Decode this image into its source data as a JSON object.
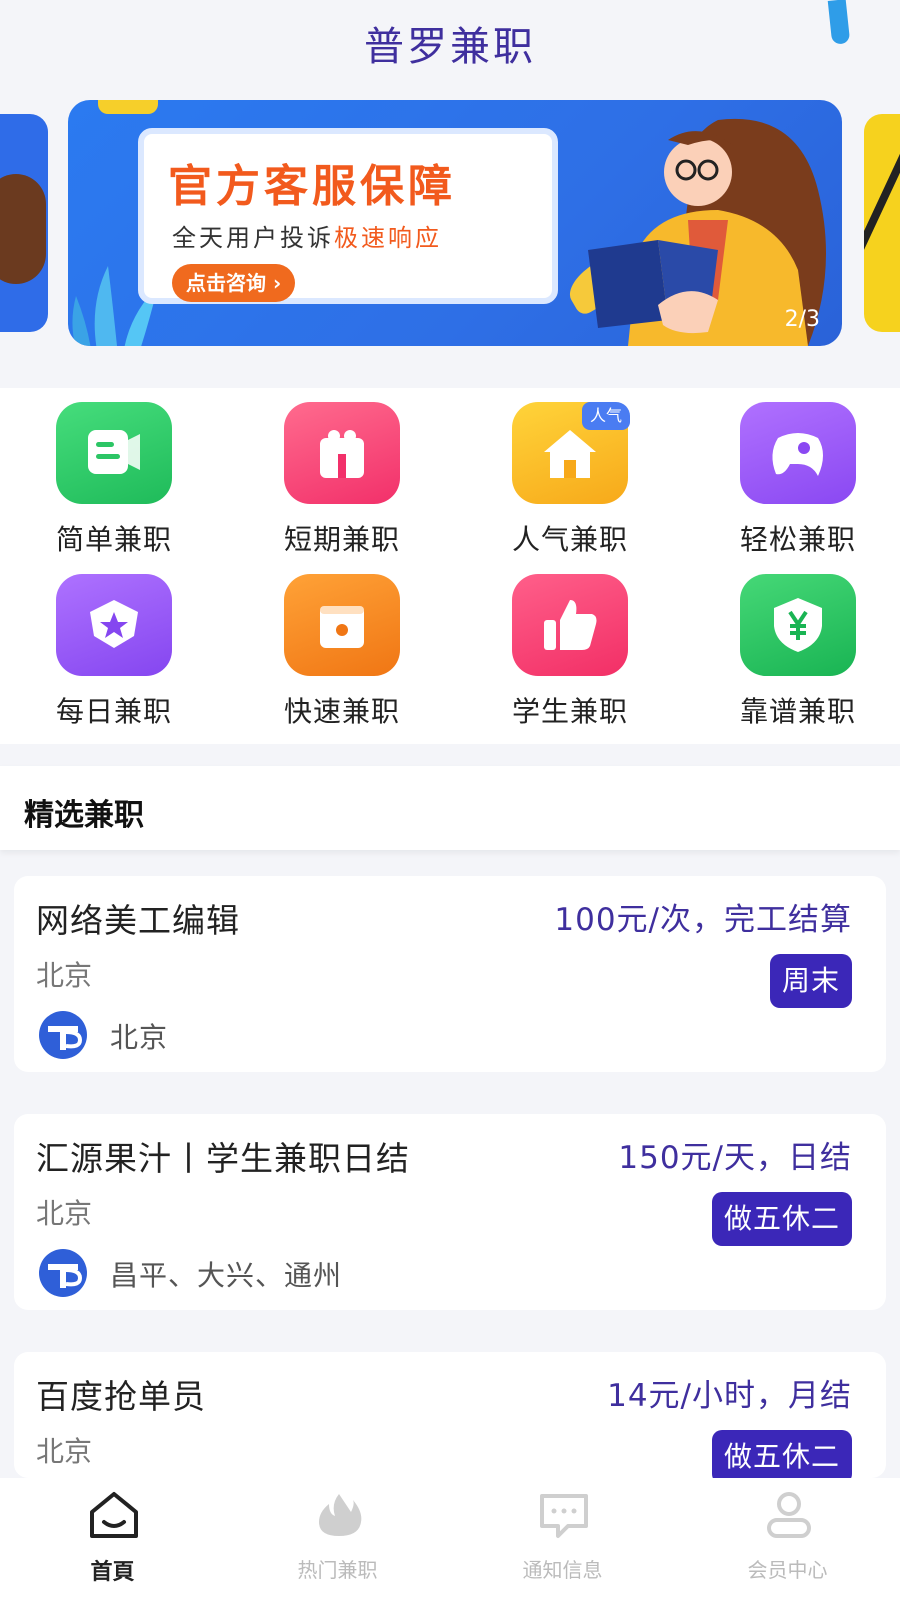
{
  "header": {
    "title": "普罗兼职"
  },
  "carousel": {
    "indicator": "2/3",
    "banner": {
      "headline": "官方客服保障",
      "subtitle_prefix": "全天用户投诉",
      "subtitle_highlight": "极速响应",
      "cta": "点击咨询 ›"
    }
  },
  "categories": [
    {
      "label": "简单兼职",
      "icon": "chat-doc-icon"
    },
    {
      "label": "短期兼职",
      "icon": "gift-box-icon"
    },
    {
      "label": "人气兼职",
      "icon": "house-icon",
      "badge": "人气"
    },
    {
      "label": "轻松兼职",
      "icon": "gamepad-icon"
    },
    {
      "label": "每日兼职",
      "icon": "star-badge-icon"
    },
    {
      "label": "快速兼职",
      "icon": "box-icon"
    },
    {
      "label": "学生兼职",
      "icon": "thumbs-up-icon"
    },
    {
      "label": "靠谱兼职",
      "icon": "yuan-shield-icon"
    }
  ],
  "section": {
    "title": "精选兼职"
  },
  "jobs": [
    {
      "title": "网络美工编辑",
      "pay": "100元/次，完工结算",
      "city": "北京",
      "tag": "周末",
      "area": "北京"
    },
    {
      "title": "汇源果汁丨学生兼职日结",
      "pay": "150元/天，日结",
      "city": "北京",
      "tag": "做五休二",
      "area": "昌平、大兴、通州"
    },
    {
      "title": "百度抢单员",
      "pay": "14元/小时，月结",
      "city": "北京",
      "tag": "做五休二",
      "area": ""
    }
  ],
  "tabbar": [
    {
      "label": "首頁",
      "icon": "home-icon",
      "active": true
    },
    {
      "label": "热门兼职",
      "icon": "flame-icon",
      "active": false
    },
    {
      "label": "通知信息",
      "icon": "message-icon",
      "active": false
    },
    {
      "label": "会员中心",
      "icon": "user-icon",
      "active": false
    }
  ],
  "colors": {
    "brand": "#3f2f9e",
    "tag": "#3b27b8",
    "accent_orange": "#f25a1d"
  }
}
